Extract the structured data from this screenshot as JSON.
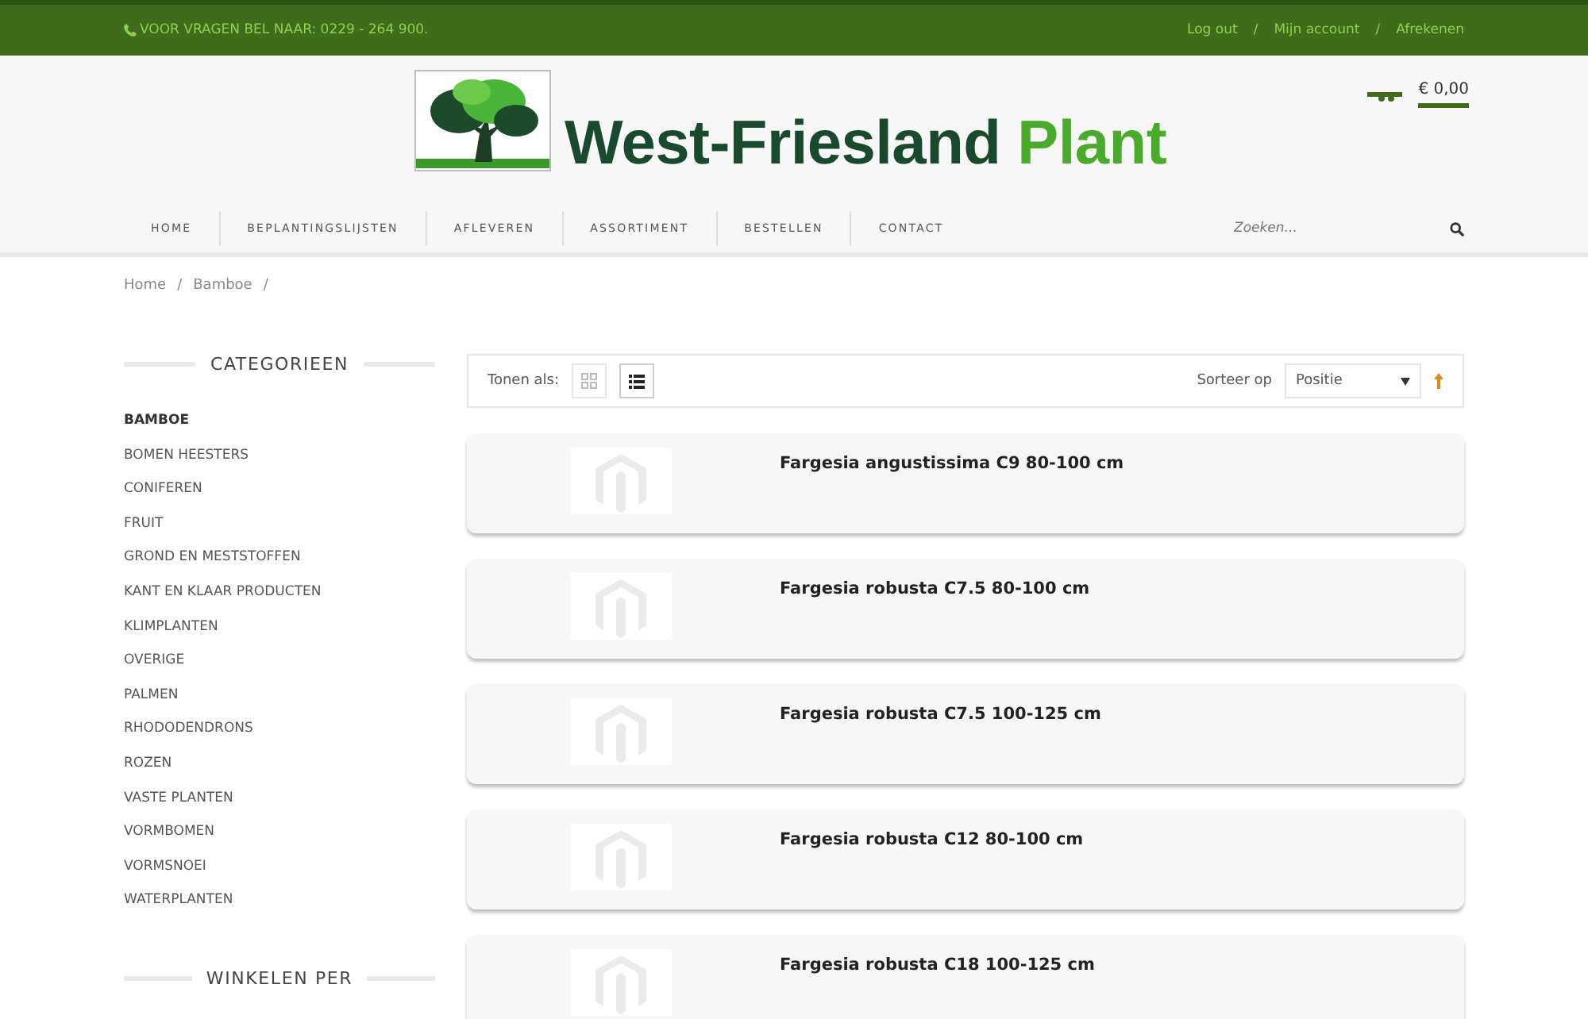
{
  "top_bar": {
    "phone": "VOOR VRAGEN BEL NAAR: 0229 - 264 900.",
    "links": [
      "Log out",
      "Mijn account",
      "Afrekenen"
    ],
    "separator": "/"
  },
  "header": {
    "logo_dark": "West-Friesland",
    "logo_light": "Plant",
    "cart_total": "€ 0,00"
  },
  "nav": {
    "items": [
      "HOME",
      "BEPLANTINGSLIJSTEN",
      "AFLEVEREN",
      "ASSORTIMENT",
      "BESTELLEN",
      "CONTACT"
    ],
    "search": {
      "placeholder": "Zoeken..."
    }
  },
  "breadcrumb": {
    "items": [
      "Home",
      "Bamboe"
    ],
    "separator": "/"
  },
  "sidebar": {
    "title": "CATEGORIEEN",
    "items": [
      {
        "label": "BAMBOE",
        "selected": true
      },
      {
        "label": "BOMEN HEESTERS",
        "selected": false
      },
      {
        "label": "CONIFEREN",
        "selected": false
      },
      {
        "label": "FRUIT",
        "selected": false
      },
      {
        "label": "GROND EN MESTSTOFFEN",
        "selected": false
      },
      {
        "label": "KANT EN KLAAR PRODUCTEN",
        "selected": false
      },
      {
        "label": "KLIMPLANTEN",
        "selected": false
      },
      {
        "label": "OVERIGE",
        "selected": false
      },
      {
        "label": "PALMEN",
        "selected": false
      },
      {
        "label": "RHODODENDRONS",
        "selected": false
      },
      {
        "label": "ROZEN",
        "selected": false
      },
      {
        "label": "VASTE PLANTEN",
        "selected": false
      },
      {
        "label": "VORMBOMEN",
        "selected": false
      },
      {
        "label": "VORMSNOEI",
        "selected": false
      },
      {
        "label": "WATERPLANTEN",
        "selected": false
      }
    ],
    "second_title": "WINKELEN PER"
  },
  "toolbar": {
    "view_label": "Tonen als:",
    "modes": [
      {
        "kind": "grid",
        "selected": false
      },
      {
        "kind": "list",
        "selected": true
      }
    ],
    "sort_label": "Sorteer op",
    "sort_value": "Positie"
  },
  "products": [
    {
      "name": "Fargesia angustissima C9 80-100 cm"
    },
    {
      "name": "Fargesia robusta C7.5 80-100 cm"
    },
    {
      "name": "Fargesia robusta C7.5 100-125 cm"
    },
    {
      "name": "Fargesia robusta C12 80-100 cm"
    },
    {
      "name": "Fargesia robusta C18 100-125 cm"
    }
  ]
}
